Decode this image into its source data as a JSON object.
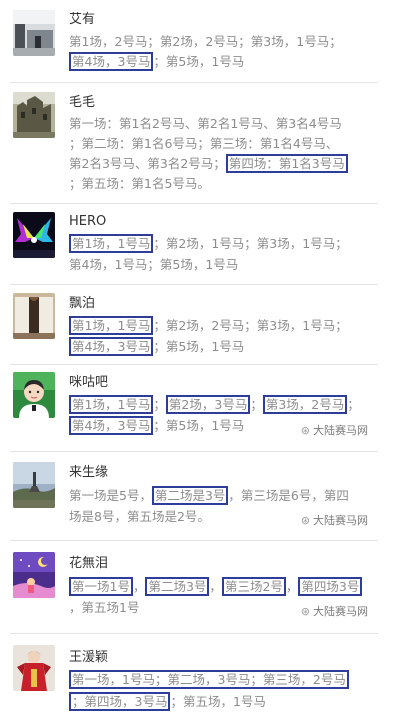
{
  "watermark": "大陆赛马网",
  "posts": [
    {
      "name": "艾有",
      "avatar": "indoor-photo-avatar",
      "lines": [
        [
          "第1场，2号马；第2场，2号马；第3场，1号马；"
        ],
        [
          "第4场，3号马",
          "；第5场，1号马"
        ]
      ]
    },
    {
      "name": "毛毛",
      "avatar": "building-photo-avatar",
      "lines": [
        [
          "第一场：第1名2号马、第2名1号马、第3名4号马"
        ],
        [
          "；第二场：第1名6号马；第三场：第1名4号马、"
        ],
        [
          "第2名3号马、第3名2号马；",
          "第四场：第1名3号马"
        ],
        [
          "；第五场：第1名5号马。"
        ]
      ]
    },
    {
      "name": "HERO",
      "avatar": "neon-wings-avatar",
      "lines": [
        [
          "第1场，1号马",
          "；第2场，1号马；第3场，1号马；"
        ],
        [
          "第4场，1号马；第5场，1号马"
        ]
      ]
    },
    {
      "name": "飘泊",
      "avatar": "room-photo-avatar",
      "lines": [
        [
          "第1场，1号马",
          "；第2场，2号马；第3场，1号马；"
        ],
        [
          "第4场，3号马",
          "；第5场，1号马"
        ]
      ]
    },
    {
      "name": "咪咕吧",
      "avatar": "child-photo-avatar",
      "lines": [
        [
          "第1场，1号马",
          "；",
          "第2场，3号马",
          "；",
          "第3场，2号马",
          "；"
        ],
        [
          "第4场，3号马",
          "；第5场，1号马"
        ]
      ]
    },
    {
      "name": "来生缘",
      "avatar": "landscape-photo-avatar",
      "lines": [
        [
          "第一场是5号，",
          "第二场是3号",
          "，第三场是6号，第四"
        ],
        [
          "场是8号，第五场是2号。"
        ]
      ]
    },
    {
      "name": "花無泪",
      "avatar": "night-cartoon-avatar",
      "lines": [
        [
          "第一场1号",
          "，",
          "第二场3号",
          "，",
          "第三场2号",
          "，",
          "第四场3号"
        ],
        [
          "，第五场1号"
        ]
      ]
    },
    {
      "name": "王湲颖",
      "avatar": "red-costume-avatar",
      "lines": [
        [
          "第一场，1号马；第二场，3号马；第三场，2号马"
        ],
        [
          "；第四场，3号马",
          "；第五场，1号马"
        ]
      ]
    }
  ]
}
